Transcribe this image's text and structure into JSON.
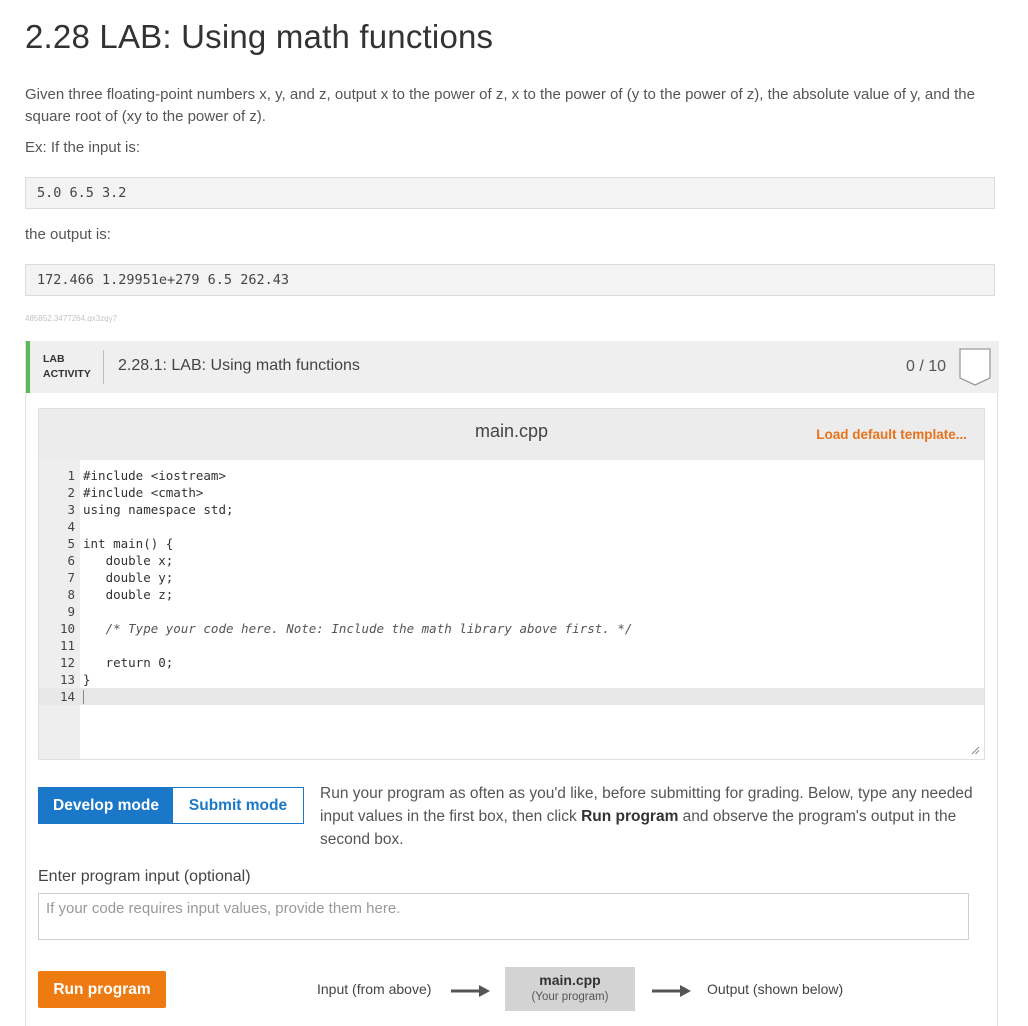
{
  "page": {
    "title": "2.28 LAB: Using math functions",
    "description": "Given three floating-point numbers x, y, and z, output x to the power of z, x to the power of (y to the power of z), the absolute value of y, and the square root of (xy to the power of z).",
    "example_label": "Ex: If the input is:",
    "example_input": "5.0 6.5 3.2",
    "output_label": "the output is:",
    "example_output": "172.466 1.29951e+279 6.5 262.43",
    "hash": "485852.3477264.qx3zqy7"
  },
  "lab": {
    "tag_line1": "LAB",
    "tag_line2": "ACTIVITY",
    "title": "2.28.1: LAB: Using math functions",
    "score": "0 / 10",
    "accent_color": "#5cb85c"
  },
  "editor": {
    "filename": "main.cpp",
    "load_default": "Load default template...",
    "lines": [
      {
        "n": "1",
        "text": "#include <iostream>"
      },
      {
        "n": "2",
        "text": "#include <cmath>"
      },
      {
        "n": "3",
        "text": "using namespace std;"
      },
      {
        "n": "4",
        "text": ""
      },
      {
        "n": "5",
        "text": "int main() {"
      },
      {
        "n": "6",
        "text": "   double x;"
      },
      {
        "n": "7",
        "text": "   double y;"
      },
      {
        "n": "8",
        "text": "   double z;"
      },
      {
        "n": "9",
        "text": ""
      },
      {
        "n": "10",
        "text": "   /* Type your code here. Note: Include the math library above first. */"
      },
      {
        "n": "11",
        "text": ""
      },
      {
        "n": "12",
        "text": "   return 0;"
      },
      {
        "n": "13",
        "text": "}"
      },
      {
        "n": "14",
        "text": ""
      }
    ]
  },
  "modes": {
    "develop": "Develop mode",
    "submit": "Submit mode",
    "desc_part1": "Run your program as often as you'd like, before submitting for grading. Below, type any needed input values in the first box, then click ",
    "desc_bold": "Run program",
    "desc_part2": " and observe the program's output in the second box."
  },
  "input": {
    "label": "Enter program input (optional)",
    "placeholder": "If your code requires input values, provide them here.",
    "value": ""
  },
  "run": {
    "button": "Run program",
    "flow_input": "Input (from above)",
    "flow_box_title": "main.cpp",
    "flow_box_sub": "(Your program)",
    "flow_output": "Output (shown below)"
  },
  "colors": {
    "primary_blue": "#1b78c9",
    "orange": "#ee7a12",
    "link_orange": "#e8731c"
  }
}
